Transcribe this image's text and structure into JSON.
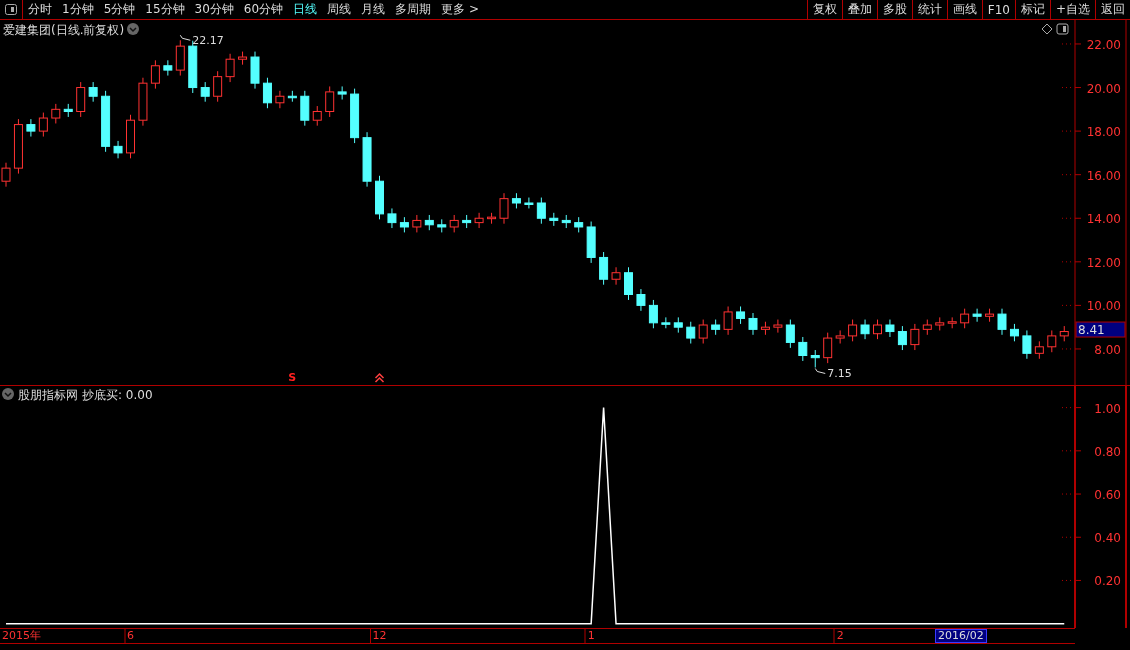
{
  "toolbar": {
    "periods": [
      {
        "label": "分时",
        "selected": false
      },
      {
        "label": "1分钟",
        "selected": false
      },
      {
        "label": "5分钟",
        "selected": false
      },
      {
        "label": "15分钟",
        "selected": false
      },
      {
        "label": "30分钟",
        "selected": false
      },
      {
        "label": "60分钟",
        "selected": false
      },
      {
        "label": "日线",
        "selected": true
      },
      {
        "label": "周线",
        "selected": false
      },
      {
        "label": "月线",
        "selected": false
      },
      {
        "label": "多周期",
        "selected": false
      },
      {
        "label": "更多 >",
        "selected": false
      }
    ],
    "buttons": [
      "复权",
      "叠加",
      "多股",
      "统计",
      "画线",
      "F10",
      "标记",
      "+自选",
      "返回"
    ]
  },
  "price_panel": {
    "title": "爱建集团(日线.前复权)",
    "last_price": "8.41",
    "date_start": "2015年",
    "date_cursor": "2016/02",
    "signals": [
      {
        "kind": "sell",
        "label": "S"
      },
      {
        "kind": "arrow"
      }
    ],
    "chart_data": {
      "type": "candlestick",
      "ylim": [
        6.3,
        23.1
      ],
      "yticks": [
        {
          "value": 8,
          "label": "8.00"
        },
        {
          "value": 10,
          "label": "10.00"
        },
        {
          "value": 12,
          "label": "12.00"
        },
        {
          "value": 14,
          "label": "14.00"
        },
        {
          "value": 16,
          "label": "16.00"
        },
        {
          "value": 18,
          "label": "18.00"
        },
        {
          "value": 20,
          "label": "20.00"
        },
        {
          "value": 22,
          "label": "22.00"
        }
      ],
      "categories": [
        null,
        null,
        null,
        null,
        null,
        null,
        null,
        null,
        null,
        null,
        null,
        null,
        null,
        null,
        null,
        null,
        null,
        null,
        null,
        null,
        null,
        null,
        null,
        null,
        null,
        null,
        null,
        null,
        null,
        null,
        null,
        null,
        null,
        null,
        null,
        null,
        null,
        null,
        null,
        null,
        null,
        null,
        null,
        null,
        null,
        null,
        null,
        null,
        null,
        null,
        null,
        null,
        null,
        null,
        null,
        null,
        null,
        null,
        null,
        null,
        null,
        null,
        null,
        null,
        null,
        null,
        null,
        null,
        null,
        null,
        null,
        null,
        null,
        null,
        null,
        null,
        null,
        null,
        null,
        null,
        null,
        null,
        null,
        null,
        null,
        null
      ],
      "ohlc": [
        [
          15.7,
          16.55,
          15.45,
          16.3
        ],
        [
          16.3,
          18.55,
          16.05,
          18.3
        ],
        [
          18.3,
          18.55,
          17.75,
          18.0
        ],
        [
          18.0,
          18.85,
          17.75,
          18.6
        ],
        [
          18.6,
          19.25,
          18.35,
          19.0
        ],
        [
          19.0,
          19.25,
          18.65,
          18.9
        ],
        [
          18.9,
          20.25,
          18.65,
          20.0
        ],
        [
          20.0,
          20.25,
          19.35,
          19.6
        ],
        [
          19.6,
          19.85,
          17.05,
          17.3
        ],
        [
          17.3,
          17.55,
          16.75,
          17.0
        ],
        [
          17.0,
          18.75,
          16.75,
          18.5
        ],
        [
          18.5,
          20.45,
          18.25,
          20.2
        ],
        [
          20.2,
          21.25,
          19.95,
          21.0
        ],
        [
          21.0,
          21.25,
          20.55,
          20.8
        ],
        [
          20.8,
          22.17,
          20.55,
          21.9
        ],
        [
          21.9,
          22.15,
          19.75,
          20.0
        ],
        [
          20.0,
          20.25,
          19.35,
          19.6
        ],
        [
          19.6,
          20.75,
          19.35,
          20.5
        ],
        [
          20.5,
          21.55,
          20.25,
          21.3
        ],
        [
          21.3,
          21.65,
          21.05,
          21.4
        ],
        [
          21.4,
          21.65,
          19.95,
          20.2
        ],
        [
          20.2,
          20.45,
          19.05,
          19.3
        ],
        [
          19.3,
          19.85,
          19.05,
          19.6
        ],
        [
          19.6,
          19.85,
          19.35,
          19.55
        ],
        [
          19.6,
          19.85,
          18.25,
          18.5
        ],
        [
          18.5,
          19.15,
          18.25,
          18.9
        ],
        [
          18.9,
          20.05,
          18.65,
          19.8
        ],
        [
          19.8,
          20.05,
          19.45,
          19.7
        ],
        [
          19.7,
          19.95,
          17.45,
          17.7
        ],
        [
          17.7,
          17.95,
          15.45,
          15.7
        ],
        [
          15.7,
          15.95,
          13.95,
          14.2
        ],
        [
          14.2,
          14.45,
          13.55,
          13.8
        ],
        [
          13.8,
          14.05,
          13.35,
          13.6
        ],
        [
          13.6,
          14.15,
          13.35,
          13.9
        ],
        [
          13.9,
          14.15,
          13.45,
          13.7
        ],
        [
          13.7,
          13.95,
          13.35,
          13.6
        ],
        [
          13.6,
          14.15,
          13.35,
          13.9
        ],
        [
          13.9,
          14.15,
          13.55,
          13.8
        ],
        [
          13.8,
          14.25,
          13.55,
          14.0
        ],
        [
          14.0,
          14.25,
          13.75,
          14.05
        ],
        [
          14.0,
          15.15,
          13.75,
          14.9
        ],
        [
          14.9,
          15.15,
          14.45,
          14.7
        ],
        [
          14.7,
          14.95,
          14.45,
          14.65
        ],
        [
          14.7,
          14.95,
          13.75,
          14.0
        ],
        [
          14.0,
          14.25,
          13.65,
          13.9
        ],
        [
          13.9,
          14.15,
          13.55,
          13.8
        ],
        [
          13.8,
          14.05,
          13.35,
          13.6
        ],
        [
          13.6,
          13.85,
          11.95,
          12.2
        ],
        [
          12.2,
          12.45,
          10.95,
          11.2
        ],
        [
          11.2,
          11.75,
          10.95,
          11.5
        ],
        [
          11.5,
          11.75,
          10.25,
          10.5
        ],
        [
          10.5,
          10.75,
          9.75,
          10.0
        ],
        [
          10.0,
          10.25,
          8.95,
          9.2
        ],
        [
          9.2,
          9.45,
          8.95,
          9.15
        ],
        [
          9.2,
          9.45,
          8.75,
          9.0
        ],
        [
          9.0,
          9.25,
          8.25,
          8.5
        ],
        [
          8.5,
          9.35,
          8.25,
          9.1
        ],
        [
          9.1,
          9.35,
          8.65,
          8.9
        ],
        [
          8.9,
          9.95,
          8.65,
          9.7
        ],
        [
          9.7,
          9.95,
          9.15,
          9.4
        ],
        [
          9.4,
          9.65,
          8.65,
          8.9
        ],
        [
          8.9,
          9.25,
          8.65,
          9.0
        ],
        [
          9.0,
          9.35,
          8.75,
          9.1
        ],
        [
          9.1,
          9.35,
          8.05,
          8.3
        ],
        [
          8.3,
          8.55,
          7.45,
          7.7
        ],
        [
          7.7,
          7.95,
          7.15,
          7.6
        ],
        [
          7.6,
          8.75,
          7.35,
          8.5
        ],
        [
          8.5,
          8.85,
          8.25,
          8.6
        ],
        [
          8.6,
          9.35,
          8.35,
          9.1
        ],
        [
          9.1,
          9.35,
          8.45,
          8.7
        ],
        [
          8.7,
          9.35,
          8.45,
          9.1
        ],
        [
          9.1,
          9.35,
          8.55,
          8.8
        ],
        [
          8.8,
          9.05,
          7.95,
          8.2
        ],
        [
          8.2,
          9.15,
          7.95,
          8.9
        ],
        [
          8.9,
          9.35,
          8.65,
          9.1
        ],
        [
          9.1,
          9.45,
          8.85,
          9.2
        ],
        [
          9.2,
          9.45,
          8.95,
          9.25
        ],
        [
          9.2,
          9.85,
          8.95,
          9.6
        ],
        [
          9.6,
          9.85,
          9.25,
          9.5
        ],
        [
          9.5,
          9.85,
          9.25,
          9.6
        ],
        [
          9.6,
          9.85,
          8.65,
          8.9
        ],
        [
          8.9,
          9.15,
          8.35,
          8.6
        ],
        [
          8.6,
          8.85,
          7.55,
          7.8
        ],
        [
          7.8,
          8.35,
          7.55,
          8.1
        ],
        [
          8.1,
          8.85,
          7.85,
          8.6
        ],
        [
          8.6,
          9.05,
          8.35,
          8.8
        ]
      ],
      "annotations": [
        "22.17",
        "7.15"
      ]
    }
  },
  "indicator_panel": {
    "name": "股朋指标网",
    "reading": "抄底买: 0.00",
    "chart_data": {
      "type": "line",
      "ylim": [
        -0.02,
        1.1
      ],
      "yticks": [
        {
          "value": 0.2,
          "label": "0.20"
        },
        {
          "value": 0.4,
          "label": "0.40"
        },
        {
          "value": 0.6,
          "label": "0.60"
        },
        {
          "value": 0.8,
          "label": "0.80"
        },
        {
          "value": 1,
          "label": "1.00"
        }
      ],
      "categories": [
        null,
        null,
        null,
        null,
        null,
        null,
        null,
        null,
        null,
        null,
        "6",
        null,
        null,
        null,
        null,
        null,
        null,
        null,
        null,
        null,
        null,
        null,
        null,
        null,
        null,
        null,
        null,
        null,
        null,
        null,
        "12",
        null,
        null,
        null,
        null,
        null,
        null,
        null,
        null,
        null,
        null,
        null,
        null,
        null,
        null,
        null,
        null,
        "1",
        null,
        null,
        null,
        null,
        null,
        null,
        null,
        null,
        null,
        null,
        null,
        null,
        null,
        null,
        null,
        null,
        null,
        null,
        null,
        "2",
        null,
        null,
        null,
        null,
        null,
        null,
        null,
        null,
        null,
        null,
        null,
        null,
        null,
        null,
        null,
        null,
        null,
        null
      ],
      "series": [
        {
          "color": "#ffffff",
          "values": [
            0,
            0,
            0,
            0,
            0,
            0,
            0,
            0,
            0,
            0,
            0,
            0,
            0,
            0,
            0,
            0,
            0,
            0,
            0,
            0,
            0,
            0,
            0,
            0,
            0,
            0,
            0,
            0,
            0,
            0,
            0,
            0,
            0,
            0,
            0,
            0,
            0,
            0,
            0,
            0,
            0,
            0,
            0,
            0,
            0,
            0,
            0,
            0,
            1,
            0,
            0,
            0,
            0,
            0,
            0,
            0,
            0,
            0,
            0,
            0,
            0,
            0,
            0,
            0,
            0,
            0,
            0,
            0,
            0,
            0,
            0,
            0,
            0,
            0,
            0,
            0,
            0,
            0,
            0,
            0,
            0,
            0,
            0,
            0,
            0,
            0
          ]
        }
      ]
    }
  }
}
